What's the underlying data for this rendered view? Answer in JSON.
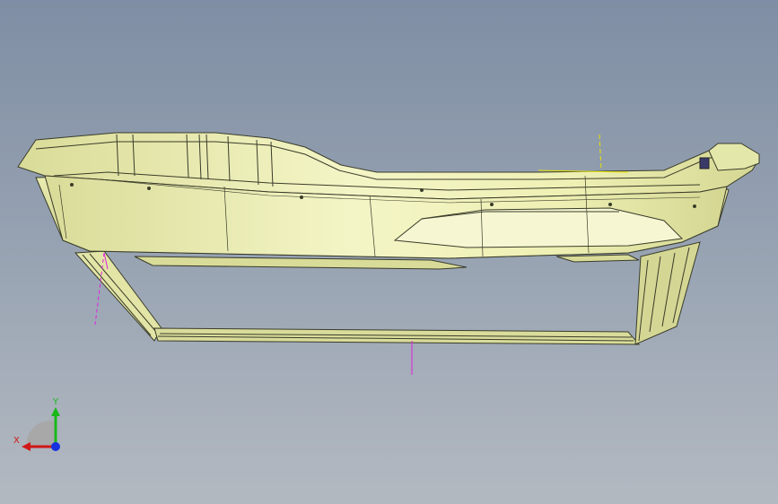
{
  "viewport": {
    "background_top": "#7f8ea4",
    "background_bottom": "#b3b9c1"
  },
  "model": {
    "part_color": "#eef0b6",
    "edge_color": "#3a3c2a",
    "sketch_line_magenta": "#e020e0",
    "sketch_line_yellow": "#e8e000"
  },
  "triad": {
    "x_label": "X",
    "y_label": "Y",
    "x_color": "#d01818",
    "y_color": "#18b818",
    "z_color": "#1830e0"
  }
}
